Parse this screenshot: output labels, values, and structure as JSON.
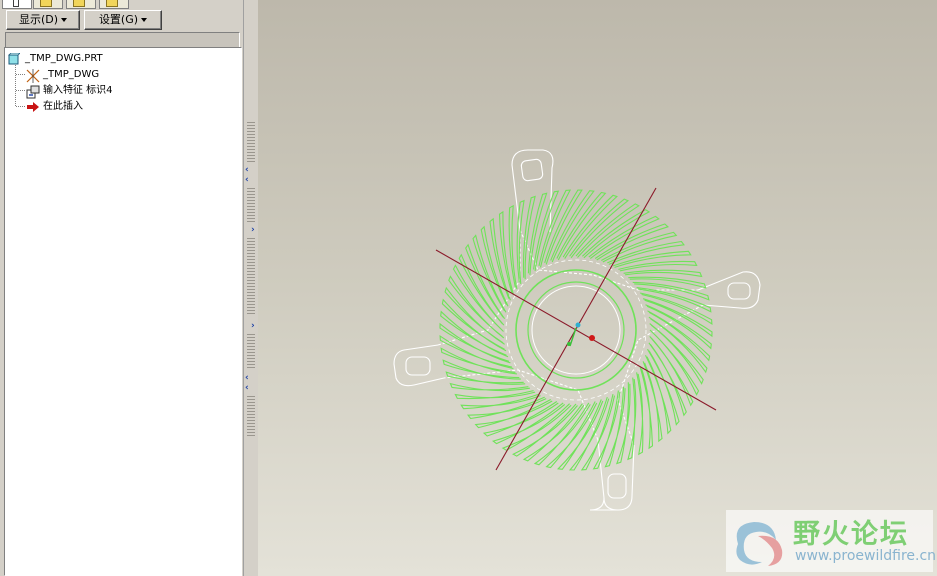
{
  "toolbar": {
    "display_label": "显示(D)",
    "settings_label": "设置(G)"
  },
  "tree": {
    "items": [
      {
        "label": "_TMP_DWG.PRT",
        "icon": "part-icon"
      },
      {
        "label": "_TMP_DWG",
        "icon": "coordinate-system-icon"
      },
      {
        "label": "输入特征 标识4",
        "icon": "import-feature-icon"
      },
      {
        "label": "在此插入",
        "icon": "insert-here-arrow-icon"
      }
    ]
  },
  "watermark": {
    "title": "野火论坛",
    "url": "www.proewildfire.cn"
  },
  "colors": {
    "model_edges": "#70e25a",
    "insert_arrow": "#c81414",
    "axis_line": "#8b1a2a"
  }
}
